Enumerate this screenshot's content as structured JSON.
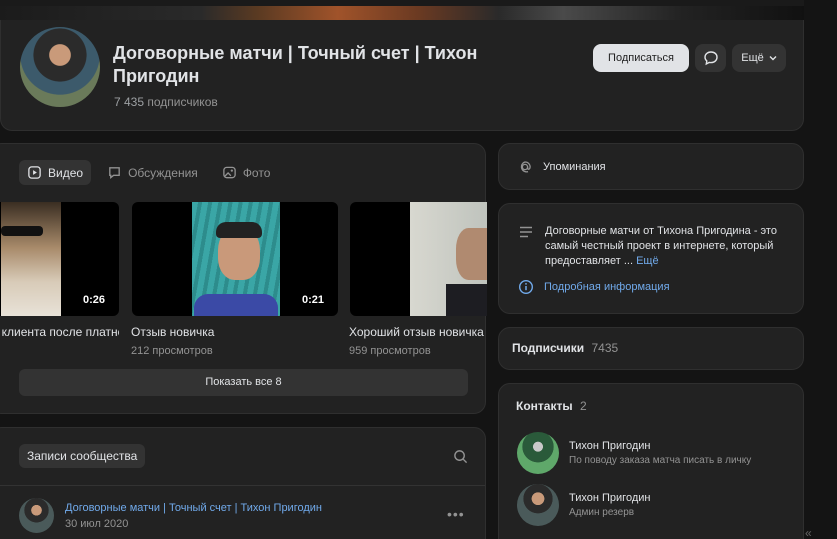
{
  "group": {
    "title": "Договорные матчи | Точный счет | Тихон Пригодин",
    "subscribers_count": "7 435",
    "subscribers_label": "подписчиков",
    "subscribe_label": "Подписаться",
    "more_label": "Ещё"
  },
  "media": {
    "tabs": [
      {
        "label": "Видео",
        "icon": "video-icon"
      },
      {
        "label": "Обсуждения",
        "icon": "discussion-icon"
      },
      {
        "label": "Фото",
        "icon": "photo-icon"
      }
    ],
    "videos": [
      {
        "title": "Отзыв клиента после платного прогноза",
        "views": "",
        "duration": "0:26"
      },
      {
        "title": "Отзыв новичка",
        "views": "212 просмотров",
        "duration": "0:21"
      },
      {
        "title": "Хороший отзыв новичка",
        "views": "959 просмотров",
        "duration": ""
      }
    ],
    "show_all_label": "Показать все 8"
  },
  "posts": {
    "filter_label": "Записи сообщества",
    "post": {
      "author": "Договорные матчи | Точный счет | Тихон Пригодин",
      "date": "30 июл 2020"
    }
  },
  "sidebar": {
    "mentions_label": "Упоминания",
    "about": {
      "text": "Договорные матчи от Тихона Пригодина - это самый честный проект в интернете, который предоставляет ...",
      "more_label": "Ещё",
      "details_label": "Подробная информация"
    },
    "followers": {
      "label": "Подписчики",
      "count": "7435"
    },
    "contacts": {
      "label": "Контакты",
      "count": "2",
      "items": [
        {
          "name": "Тихон Пригодин",
          "description": "По поводу заказа матча писать в личку"
        },
        {
          "name": "Тихон Пригодин",
          "description": "Админ резерв"
        }
      ]
    }
  },
  "colors": {
    "link": "#71aaeb",
    "card": "#222222",
    "background": "#141414"
  }
}
